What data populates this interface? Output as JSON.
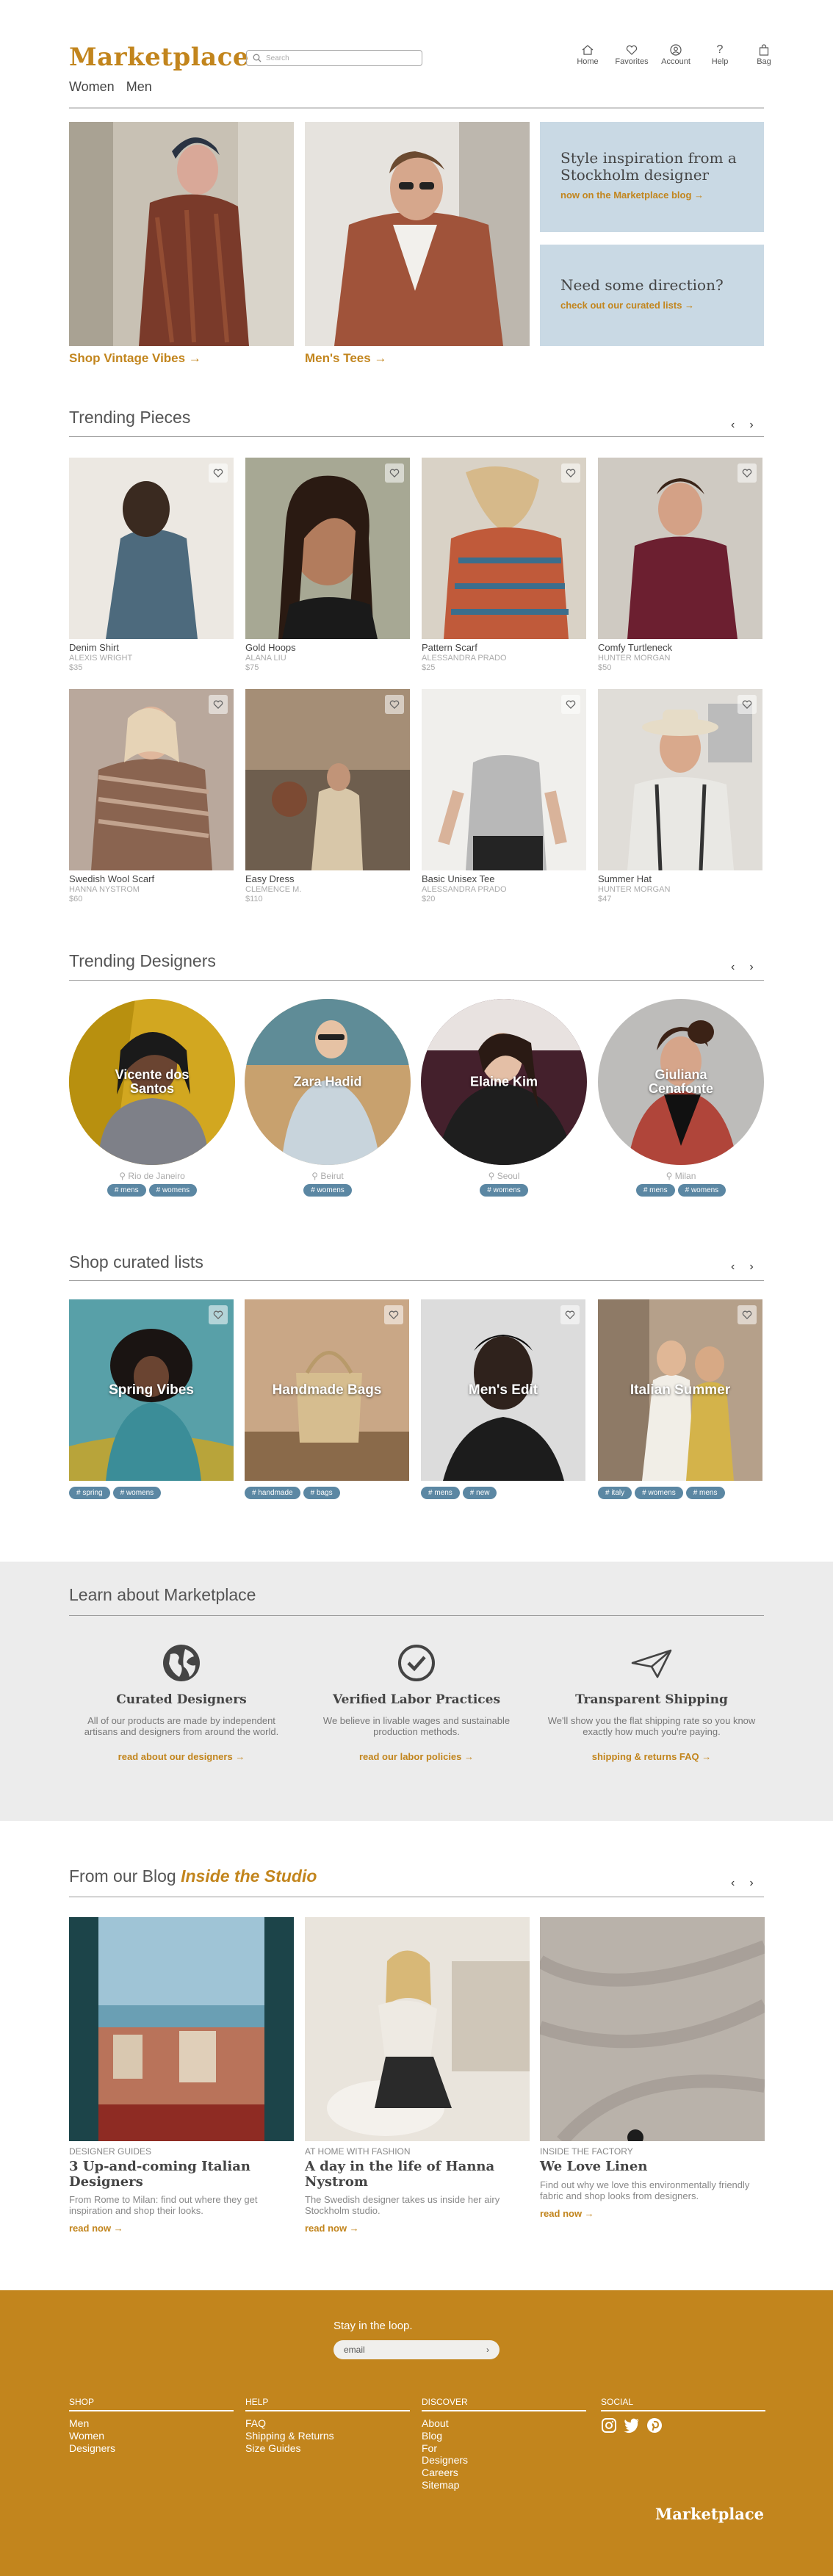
{
  "header": {
    "logo": "Marketplace",
    "search_placeholder": "Search",
    "nav": [
      {
        "label": "Home",
        "icon": "home-icon"
      },
      {
        "label": "Favorites",
        "icon": "heart-icon"
      },
      {
        "label": "Account",
        "icon": "account-icon"
      },
      {
        "label": "Help",
        "icon": "help-icon"
      },
      {
        "label": "Bag",
        "icon": "bag-icon"
      }
    ],
    "categories": [
      "Women",
      "Men"
    ]
  },
  "hero": {
    "links": [
      "Shop Vintage Vibes →",
      "Men's Tees →"
    ],
    "promos": [
      {
        "title": "Style inspiration from a Stockholm designer",
        "link": "now on the Marketplace blog →"
      },
      {
        "title": "Need some direction?",
        "link": "check out our curated lists →"
      }
    ]
  },
  "trending_pieces": {
    "title": "Trending Pieces",
    "items": [
      {
        "name": "Denim Shirt",
        "designer": "ALEXIS WRIGHT",
        "price": "$35"
      },
      {
        "name": "Gold Hoops",
        "designer": "ALANA LIU",
        "price": "$75"
      },
      {
        "name": "Pattern Scarf",
        "designer": "ALESSANDRA PRADO",
        "price": "$25"
      },
      {
        "name": "Comfy Turtleneck",
        "designer": "HUNTER MORGAN",
        "price": "$50"
      },
      {
        "name": "Swedish Wool Scarf",
        "designer": "HANNA NYSTROM",
        "price": "$60"
      },
      {
        "name": "Easy Dress",
        "designer": "CLEMENCE M.",
        "price": "$110"
      },
      {
        "name": "Basic Unisex Tee",
        "designer": "ALESSANDRA PRADO",
        "price": "$20"
      },
      {
        "name": "Summer Hat",
        "designer": "HUNTER MORGAN",
        "price": "$47"
      }
    ]
  },
  "trending_designers": {
    "title": "Trending Designers",
    "items": [
      {
        "name": "Vicente dos Santos",
        "location": "Rio de Janeiro",
        "tags": [
          "# mens",
          "# womens"
        ]
      },
      {
        "name": "Zara Hadid",
        "location": "Beirut",
        "tags": [
          "# womens"
        ]
      },
      {
        "name": "Elaine Kim",
        "location": "Seoul",
        "tags": [
          "# womens"
        ]
      },
      {
        "name": "Giuliana Cenafonte",
        "location": "Milan",
        "tags": [
          "# mens",
          "# womens"
        ]
      }
    ]
  },
  "curated": {
    "title": "Shop curated lists",
    "items": [
      {
        "name": "Spring Vibes",
        "tags": [
          "# spring",
          "# womens"
        ]
      },
      {
        "name": "Handmade Bags",
        "tags": [
          "# handmade",
          "# bags"
        ]
      },
      {
        "name": "Men's Edit",
        "tags": [
          "# mens",
          "# new"
        ]
      },
      {
        "name": "Italian Summer",
        "tags": [
          "# italy",
          "# womens",
          "# mens"
        ]
      }
    ]
  },
  "learn": {
    "title": "Learn about Marketplace",
    "features": [
      {
        "icon": "globe-icon",
        "title": "Curated Designers",
        "desc": "All of our products are made by independent artisans and designers from around the world.",
        "link": "read about our designers →"
      },
      {
        "icon": "check-circle-icon",
        "title": "Verified Labor Practices",
        "desc": "We believe in livable wages and sustainable production methods.",
        "link": "read our labor policies →"
      },
      {
        "icon": "paper-plane-icon",
        "title": "Transparent Shipping",
        "desc": "We'll show you the flat shipping rate so you know exactly how much you're paying.",
        "link": "shipping & returns FAQ →"
      }
    ]
  },
  "blog": {
    "title_prefix": "From our Blog",
    "title_accent": "Inside the Studio",
    "posts": [
      {
        "category": "DESIGNER GUIDES",
        "title": "3 Up-and-coming Italian Designers",
        "desc": "From Rome to Milan: find out where they get inspiration and shop their looks.",
        "link": "read now →"
      },
      {
        "category": "AT HOME WITH FASHION",
        "title": "A day in the life of Hanna Nystrom",
        "desc": "The Swedish designer takes us inside her airy Stockholm studio.",
        "link": "read now →"
      },
      {
        "category": "INSIDE THE FACTORY",
        "title": "We Love Linen",
        "desc": "Find out why we love this environmentally friendly fabric and shop looks from designers.",
        "link": "read now →"
      }
    ]
  },
  "footer": {
    "stay": "Stay in the loop.",
    "email_placeholder": "email",
    "columns": [
      {
        "heading": "SHOP",
        "items": [
          "Men",
          "Women",
          "Designers"
        ]
      },
      {
        "heading": "HELP",
        "items": [
          "FAQ",
          "Shipping & Returns",
          "Size Guides"
        ]
      },
      {
        "heading": "DISCOVER",
        "items": [
          "About",
          "Blog",
          "For",
          "Designers",
          "Careers",
          "Sitemap"
        ]
      },
      {
        "heading": "SOCIAL",
        "items": []
      }
    ],
    "social_icons": [
      "instagram-icon",
      "twitter-icon",
      "pinterest-icon"
    ],
    "logo": "Marketplace"
  },
  "colors": {
    "accent": "#c2851d",
    "promo_bg": "#c9d9e4",
    "tag_bg": "#5b87a3",
    "learn_bg": "#ececec"
  }
}
